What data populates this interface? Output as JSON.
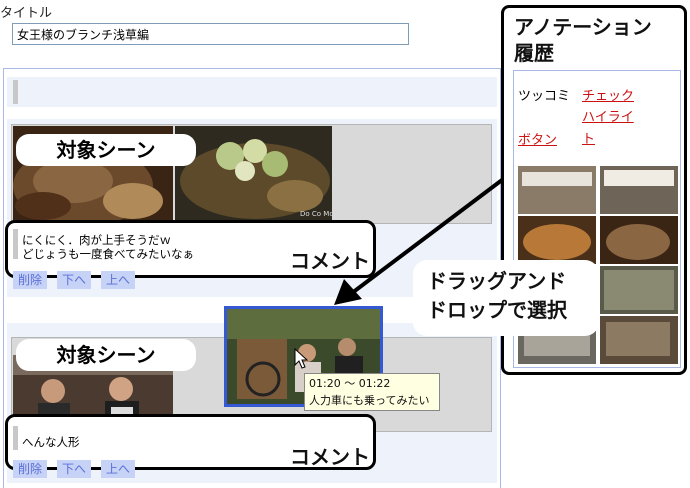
{
  "title_label": "タイトル",
  "title_value": "女王様のブランチ浅草編",
  "annotations": [
    {
      "scene_callout": "対象シーン",
      "comment_callout": "コメント",
      "comment_lines": [
        "にくにく．肉が上手そうだｗ",
        "どじょうも一度食べてみたいなぁ"
      ],
      "buttons": [
        "削除",
        "下へ",
        "上へ"
      ],
      "thumb_watermark": "Do Co Mo"
    },
    {
      "scene_callout": "対象シーン",
      "comment_callout": "コメント",
      "comment_lines": [
        "へんな人形"
      ],
      "buttons": [
        "削除",
        "下へ",
        "上へ"
      ]
    }
  ],
  "history": {
    "title_line1": "アノテーション",
    "title_line2": "履歴",
    "tabs": [
      {
        "label": "ツッコミ",
        "link": false
      },
      {
        "label": "チェック",
        "link": true
      },
      {
        "label": "ハイライト",
        "link": true
      },
      {
        "label": "ボタン",
        "link": true
      }
    ]
  },
  "drag_label": [
    "ドラッグアンド",
    "ドロップで選択"
  ],
  "tooltip": {
    "time": "01:20 ～ 01:22",
    "caption": "人力車にも乗ってみたい"
  },
  "colors": {
    "accent_blue": "#3559d2",
    "link_red": "#cc1111",
    "button_bg": "#c7d2f7"
  }
}
